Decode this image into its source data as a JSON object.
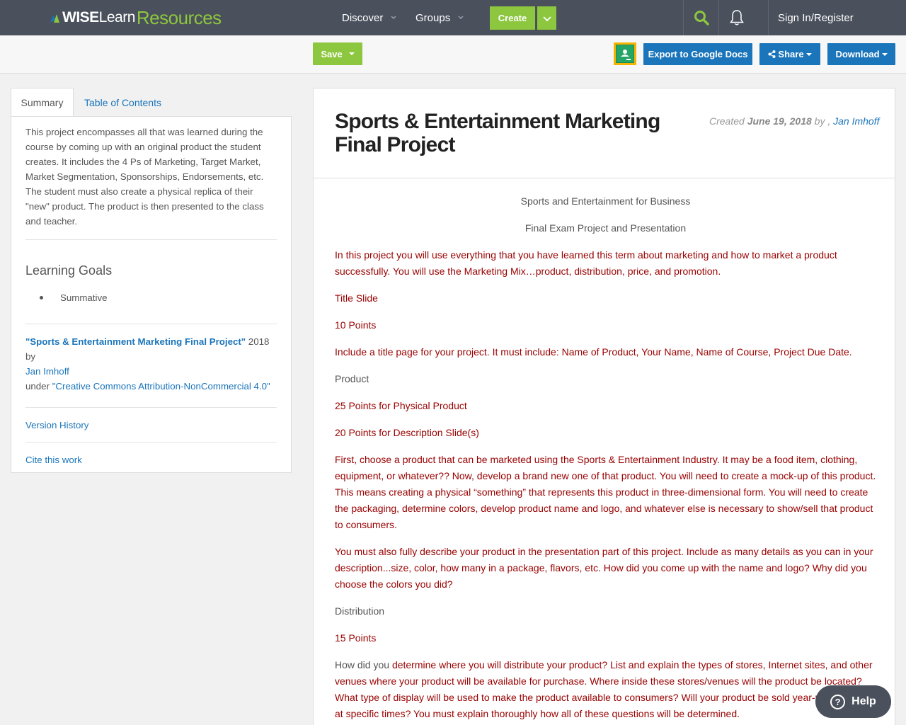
{
  "nav": {
    "logo_wise": "WISE",
    "logo_learn": "Learn",
    "logo_resources": "Resources",
    "discover": "Discover",
    "groups": "Groups",
    "create": "Create",
    "signin": "Sign In/Register"
  },
  "toolbar": {
    "save": "Save",
    "export": "Export to Google Docs",
    "share": "Share",
    "download": "Download"
  },
  "tabs": {
    "summary": "Summary",
    "toc": "Table of Contents"
  },
  "sidebar": {
    "summary_text": "This project encompasses all that was learned during the course by coming up with an original product the student creates. It includes the 4 Ps of Marketing, Target Market, Market Segmentation, Sponsorships, Endorsements, etc. The student must also create a physical replica of their \"new\" product. The product is then presented to the class and teacher.",
    "learning_goals_heading": "Learning Goals",
    "learning_goals": [
      "Summative"
    ],
    "attr_title": "\"Sports & Entertainment Marketing Final Project\"",
    "attr_year_by": " 2018 by",
    "attr_author": "Jan Imhoff",
    "attr_under": "under ",
    "attr_license": "\"Creative Commons Attribution-NonCommercial 4.0\"",
    "version_history": "Version History",
    "cite": "Cite this work"
  },
  "doc": {
    "title": "Sports & Entertainment Marketing Final Project",
    "created_label": "Created ",
    "created_date": "June 19, 2018",
    "created_by": " by , ",
    "created_author": "Jan Imhoff",
    "p1": "Sports and Entertainment for Business",
    "p2": "Final Exam Project and Presentation",
    "p3": "In this project you will use everything that you have learned this term about marketing and how to market a product successfully.  You will use the Marketing Mix…product, distribution, price, and promotion.",
    "p4": "Title Slide",
    "p5": "10 Points",
    "p6": "Include a title page for your project.  It must include:  Name of Product, Your Name, Name of Course, Project Due Date.",
    "p7": "Product",
    "p8": "25 Points for Physical Product",
    "p9": "20 Points for Description Slide(s)",
    "p10": "First, choose a product that can be marketed using the Sports & Entertainment Industry.  It may be a food item, clothing, equipment, or whatever??  Now, develop a brand new one of that product.  You will need to create a mock-up of this product.  This means creating a physical “something” that represents this product in three-dimensional form.  You will need to create the packaging, determine colors, develop product name and logo, and whatever else is necessary to show/sell that product to consumers.",
    "p11": "You must also fully describe your product in the presentation part of this project. Include as many details as you can in your description...size, color, how many in a package, flavors, etc. How did you come up with the name and logo? Why did you choose the colors you did?",
    "p12": "Distribution",
    "p13": "15 Points",
    "p14_gray": "How did you ",
    "p14_red": "determine where you will distribute your product?  List and explain the types of stores, Internet sites, and other venues where your product will be available for purchase.  Where inside these stores/venues will the product be located?  What type of display will be used to make the product available to consumers?  Will your product be sold year-round or only at specific times?  You must explain thoroughly how all of these questions will be determined."
  },
  "help": {
    "label": "Help",
    "icon_glyph": "?"
  },
  "colors": {
    "nav_bg": "#4a505c",
    "brand_green": "#8dc63f",
    "link_blue": "#1b75bb",
    "doc_red": "#990000"
  }
}
